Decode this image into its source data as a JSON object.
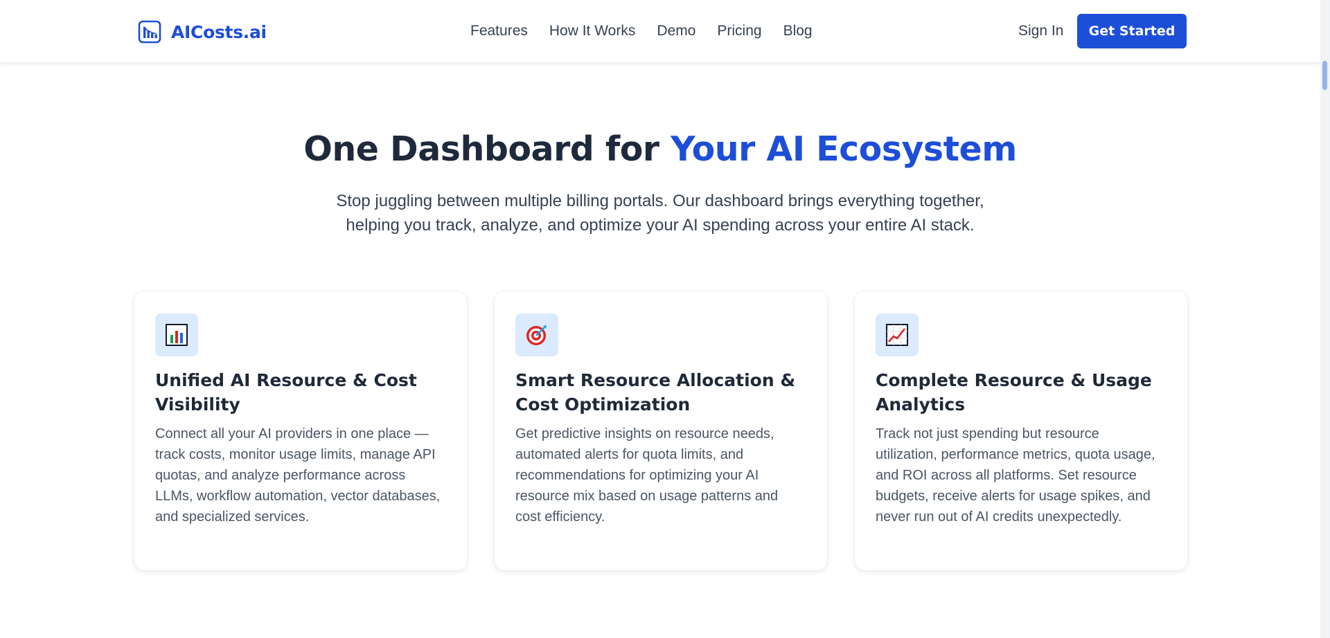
{
  "header": {
    "logo_text": "AICosts.ai",
    "logo_icon": "bar-chart-logo-icon",
    "nav": [
      {
        "label": "Features"
      },
      {
        "label": "How It Works"
      },
      {
        "label": "Demo"
      },
      {
        "label": "Pricing"
      },
      {
        "label": "Blog"
      }
    ],
    "sign_in_label": "Sign In",
    "cta_label": "Get Started"
  },
  "hero": {
    "title_prefix": "One Dashboard for ",
    "title_accent": "Your AI Ecosystem",
    "subtitle": "Stop juggling between multiple billing portals. Our dashboard brings everything together, helping you track, analyze, and optimize your AI spending across your entire AI stack."
  },
  "features": [
    {
      "icon": "bar-chart-icon",
      "title": "Unified AI Resource & Cost Visibility",
      "description": "Connect all your AI providers in one place — track costs, monitor usage limits, manage API quotas, and analyze performance across LLMs, workflow automation, vector databases, and specialized services."
    },
    {
      "icon": "target-icon",
      "title": "Smart Resource Allocation & Cost Optimization",
      "description": "Get predictive insights on resource needs, automated alerts for quota limits, and recommendations for optimizing your AI resource mix based on usage patterns and cost efficiency."
    },
    {
      "icon": "trending-up-chart-icon",
      "title": "Complete Resource & Usage Analytics",
      "description": "Track not just spending but resource utilization, performance metrics, quota usage, and ROI across all platforms. Set resource budgets, receive alerts for usage spikes, and never run out of AI credits unexpectedly."
    }
  ],
  "colors": {
    "brand": "#1d4ed8",
    "heading": "#1e293b",
    "body_text": "#4b5563",
    "icon_tile": "#dbeafe"
  }
}
